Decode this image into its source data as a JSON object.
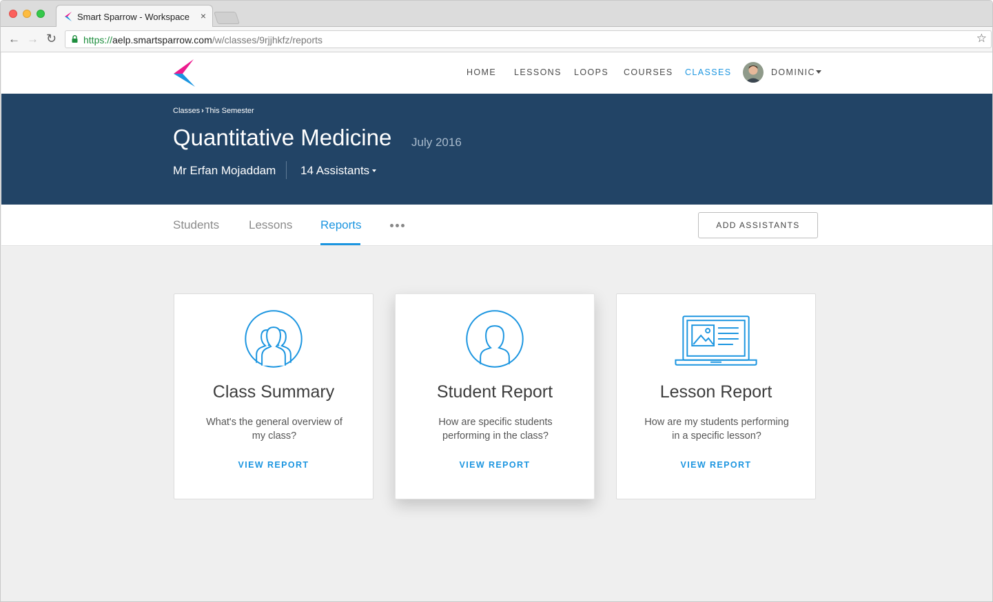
{
  "browser": {
    "tab_title": "Smart Sparrow - Workspace",
    "tab_close": "×",
    "url_scheme": "https://",
    "url_host": "aelp.smartsparrow.com",
    "url_path": "/w/classes/9rjjhkfz/reports",
    "icons": {
      "back": "arrow-left-icon",
      "forward": "arrow-right-icon",
      "reload": "reload-icon",
      "lock": "lock-icon",
      "bookmark": "star-icon"
    }
  },
  "header": {
    "nav": [
      {
        "label": "HOME",
        "active": false
      },
      {
        "label": "LESSONS",
        "active": false
      },
      {
        "label": "LOOPS",
        "active": false
      },
      {
        "label": "COURSES",
        "active": false
      },
      {
        "label": "CLASSES",
        "active": true
      }
    ],
    "user_name": "DOMINIC"
  },
  "banner": {
    "breadcrumb": [
      "Classes",
      "This Semester"
    ],
    "title": "Quantitative Medicine",
    "date": "July 2016",
    "teacher": "Mr Erfan Mojaddam",
    "assistants": "14 Assistants"
  },
  "tabs": {
    "items": [
      {
        "label": "Students",
        "active": false
      },
      {
        "label": "Lessons",
        "active": false
      },
      {
        "label": "Reports",
        "active": true
      }
    ],
    "add_button": "ADD ASSISTANTS"
  },
  "cards": [
    {
      "icon": "group-icon",
      "title": "Class Summary",
      "description": "What's the general overview of my class?",
      "link": "VIEW REPORT"
    },
    {
      "icon": "person-icon",
      "title": "Student Report",
      "description": "How are specific students performing in the class?",
      "link": "VIEW REPORT"
    },
    {
      "icon": "laptop-lesson-icon",
      "title": "Lesson Report",
      "description": "How are my students performing in a specific lesson?",
      "link": "VIEW REPORT"
    }
  ],
  "colors": {
    "accent": "#1b95e0",
    "banner": "#224466",
    "content_bg": "#efefef",
    "logo_magenta": "#ec1b8e",
    "logo_blue": "#1b95e0"
  }
}
